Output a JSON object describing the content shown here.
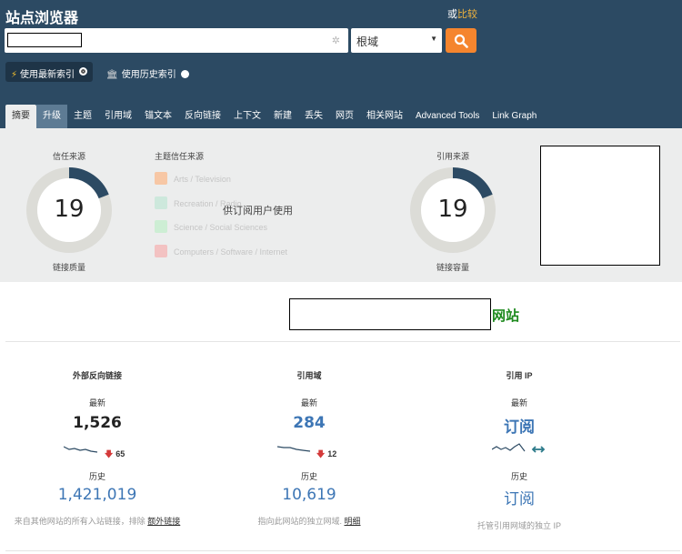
{
  "header": {
    "title": "站点浏览器",
    "compare_prefix": "或",
    "compare_link": "比较",
    "search": {
      "value": "",
      "settings_icon": "gear-icon"
    },
    "scope_select": {
      "selected": "根域"
    },
    "search_button_icon": "search-icon",
    "index_fresh": "使用最新索引",
    "index_historic": "使用历史索引"
  },
  "tabs": [
    "摘要",
    "升级",
    "主题",
    "引用域",
    "锚文本",
    "反向链接",
    "上下文",
    "新建",
    "丢失",
    "网页",
    "相关网站",
    "Advanced Tools",
    "Link Graph"
  ],
  "summary": {
    "trust_flow": {
      "title": "信任来源",
      "value": "19",
      "caption": "链接质量",
      "fill_fraction": 0.19
    },
    "topics": {
      "title": "主题信任来源",
      "items": [
        {
          "label": "Arts / Television",
          "color": "#f7c7a5"
        },
        {
          "label": "Recreation / Radio",
          "color": "#cde8dc"
        },
        {
          "label": "Science / Social Sciences",
          "color": "#cdeed4"
        },
        {
          "label": "Computers / Software / Internet",
          "color": "#f3c2c2"
        }
      ]
    },
    "subscriber_note": "供订阅用户使用",
    "citation_flow": {
      "title": "引用来源",
      "value": "19",
      "caption": "链接容量",
      "fill_fraction": 0.19
    }
  },
  "site": {
    "suffix": "网站"
  },
  "stats": [
    {
      "title": "外部反向链接",
      "latest_label": "最新",
      "latest": "1,526",
      "delta": "65",
      "history_label": "历史",
      "history": "1,421,019",
      "desc": "来自其他网站的所有入站链接，排除 ",
      "desc_link": "额外链接"
    },
    {
      "title": "引用域",
      "latest_label": "最新",
      "latest": "284",
      "delta": "12",
      "history_label": "历史",
      "history": "10,619",
      "desc": "指向此网站的独立网域. ",
      "desc_link": "明细"
    },
    {
      "title": "引用 IP",
      "latest_label": "最新",
      "latest": "订阅",
      "delta": "",
      "history_label": "历史",
      "history": "订阅",
      "desc": "托管引用网域的独立 IP",
      "desc_link": ""
    }
  ],
  "colors": {
    "header_bg": "#2c4a63",
    "accent_orange": "#f5852e",
    "donut_fill": "#2c4a63",
    "link_blue": "#3d76b5",
    "site_green": "#1e8a1e"
  }
}
